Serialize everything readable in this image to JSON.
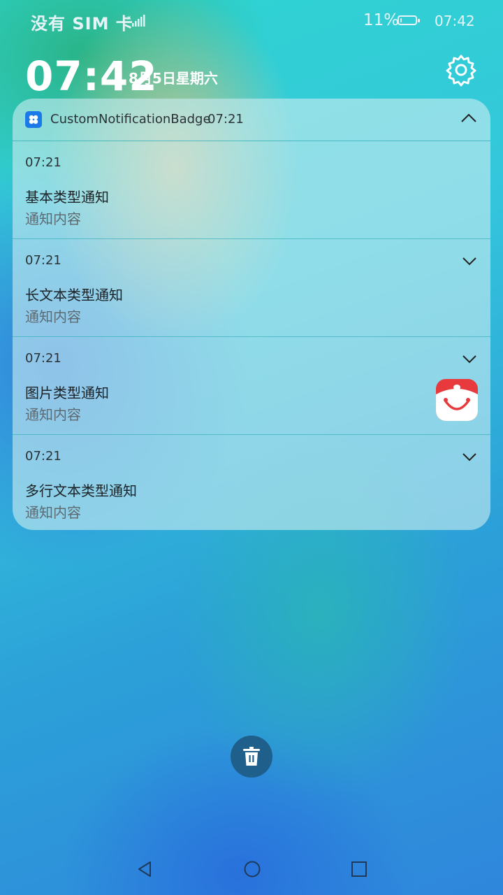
{
  "status_bar": {
    "carrier": "没有 SIM 卡",
    "battery": "11%",
    "battery_level_fraction": 0.11,
    "time": "07:42"
  },
  "lock_screen": {
    "clock": "07:42",
    "date": "8月5日星期六",
    "settings_icon": "gear-icon"
  },
  "notification_group": {
    "app_name": "CustomNotificationBadge",
    "time": "07:21",
    "app_icon": "four-leaf-app-icon",
    "collapse_icon": "chevron-up-icon",
    "items": [
      {
        "time": "07:21",
        "title": "基本类型通知",
        "body": "通知内容"
      },
      {
        "time": "07:21",
        "title": "长文本类型通知",
        "body": "通知内容",
        "expand_icon": "chevron-down-icon"
      },
      {
        "time": "07:21",
        "title": "图片类型通知",
        "body": "通知内容",
        "expand_icon": "chevron-down-icon",
        "image": "smiley-app-image"
      },
      {
        "time": "07:21",
        "title": "多行文本类型通知",
        "body": "通知内容",
        "expand_icon": "chevron-down-icon"
      }
    ]
  },
  "actions": {
    "clear_all_icon": "trash-icon"
  },
  "navigation": {
    "back_icon": "back-triangle-icon",
    "home_icon": "home-circle-icon",
    "recent_icon": "recent-square-icon"
  },
  "colors": {
    "accent": "#1a7be8",
    "trash_button": "#1f5f8c",
    "image_red": "#e8393c"
  }
}
